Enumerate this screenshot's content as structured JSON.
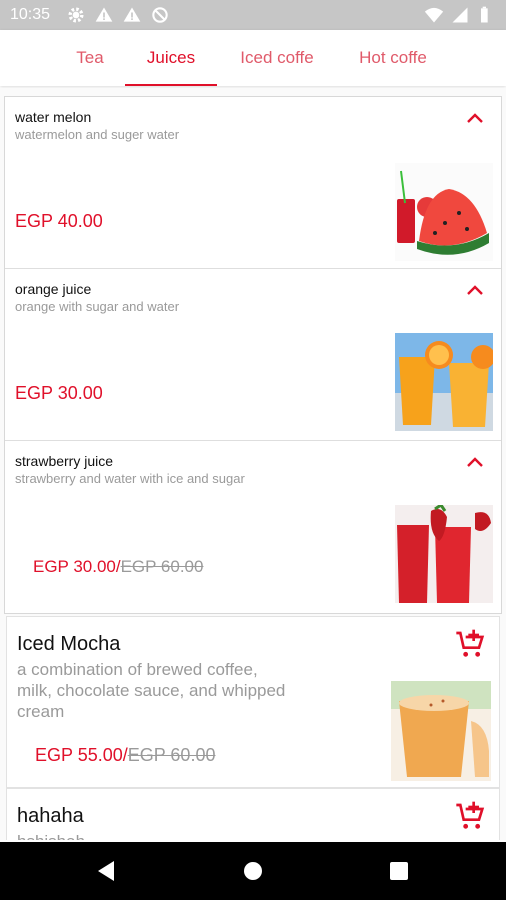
{
  "status_bar": {
    "time": "10:35",
    "left_icons": [
      "gear-icon",
      "warning-icon",
      "warning-icon",
      "no-sync-icon"
    ],
    "right_icons": [
      "wifi-icon",
      "signal-icon",
      "battery-icon"
    ]
  },
  "tabs": [
    {
      "label": "Tea",
      "active": false
    },
    {
      "label": "Juices",
      "active": true
    },
    {
      "label": "Iced coffe",
      "active": false
    },
    {
      "label": "Hot coffe",
      "active": false
    }
  ],
  "juices": [
    {
      "name": "water melon",
      "description": "watermelon and suger water",
      "price": "EGP 40.00",
      "old_price": "",
      "expand_icon": "chevron-up-icon"
    },
    {
      "name": "orange juice",
      "description": "orange  with sugar and water",
      "price": "EGP 30.00",
      "old_price": "",
      "expand_icon": "chevron-up-icon"
    },
    {
      "name": "strawberry juice",
      "description": "strawberry and water with ice and sugar",
      "price": "EGP 30.00/",
      "old_price": "EGP 60.00",
      "expand_icon": "chevron-up-icon"
    }
  ],
  "products": [
    {
      "name": "Iced Mocha",
      "description": "a combination of brewed coffee, milk, chocolate sauce, and whipped cream",
      "price": "EGP 55.00/",
      "old_price": "EGP 60.00",
      "action_icon": "add-to-cart-icon"
    },
    {
      "name": "hahaha",
      "description": "hshishah",
      "action_icon": "add-to-cart-icon"
    }
  ],
  "nav_bar": {
    "icons": [
      "back-icon",
      "home-icon",
      "recents-icon"
    ]
  },
  "colors": {
    "accent": "#e0102a",
    "tab_inactive": "#e05a6a",
    "muted_text": "#9a9a9a",
    "status_bar": "#c6c6c6"
  }
}
